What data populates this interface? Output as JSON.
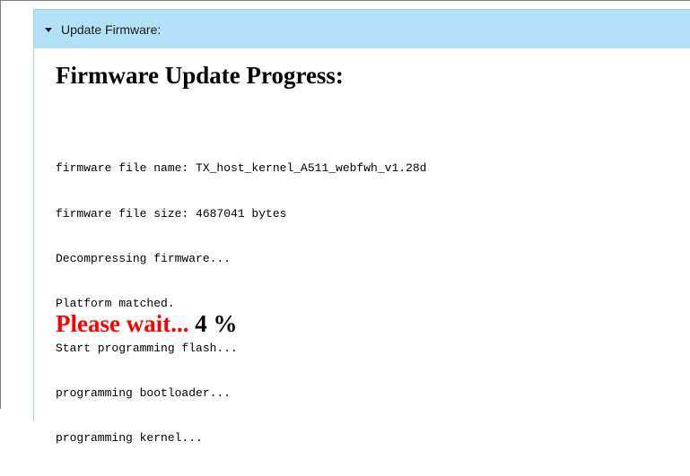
{
  "panel": {
    "header_label": "Update Firmware:"
  },
  "progress": {
    "title": "Firmware Update Progress:",
    "log_lines": [
      "firmware file name: TX_host_kernel_A511_webfwh_v1.28d",
      "firmware file size: 4687041 bytes",
      "Decompressing firmware...",
      "Platform matched.",
      "Start programming flash...",
      "programming bootloader...",
      "programming kernel..."
    ],
    "wait_text": "Please wait...",
    "percent_text": "4 %",
    "percent_value": 4
  },
  "colors": {
    "header_background": "#b3e1f8",
    "wait_text": "#ff0000"
  },
  "icons": {
    "header_toggle": "caret-down-icon"
  }
}
